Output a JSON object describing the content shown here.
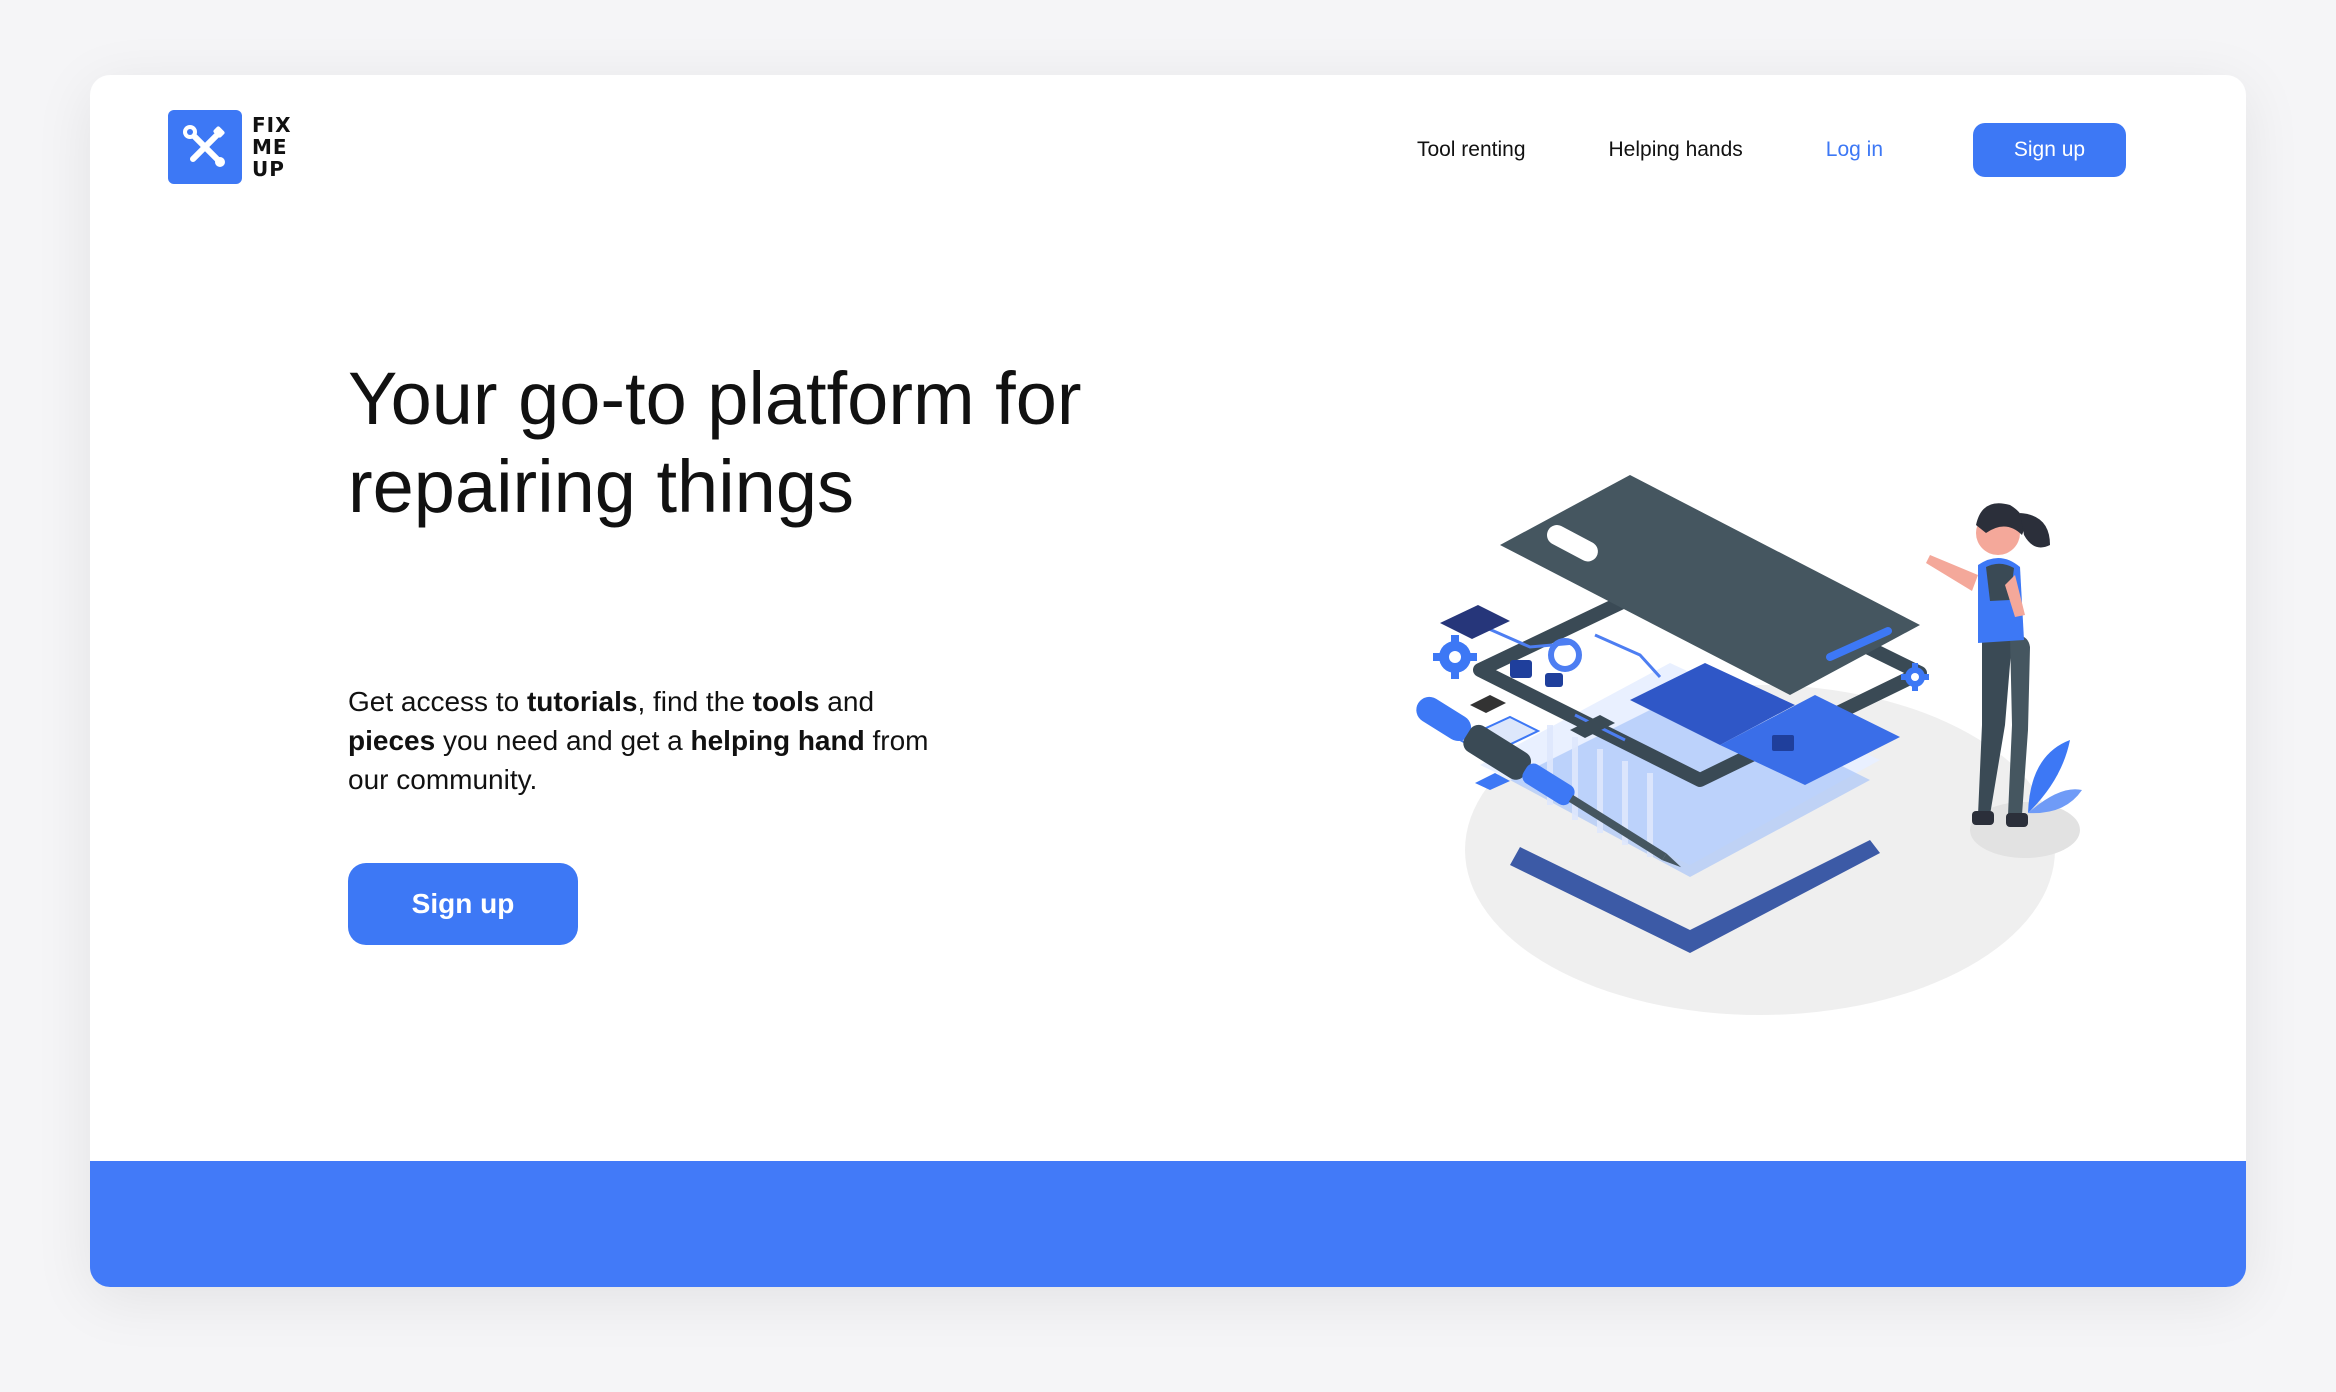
{
  "brand": {
    "logo_line1": "FIX",
    "logo_line2": "ME",
    "logo_line3": "UP",
    "logo_icon": "wrench-screwdriver-icon",
    "accent_color": "#3d78f5"
  },
  "nav": {
    "items": [
      {
        "label": "Tool renting"
      },
      {
        "label": "Helping hands"
      }
    ],
    "login_label": "Log in",
    "signup_label": "Sign up"
  },
  "hero": {
    "headline_line1": "Your go-to platform for",
    "headline_line2": "repairing things",
    "sub": {
      "t1": "Get access to ",
      "b1": "tutorials",
      "t2": ", find the ",
      "b2": "tools",
      "t3": " and",
      "b3": "pieces",
      "t4": " you need and get a ",
      "b4": "helping hand",
      "t5": " from",
      "t6": "our community."
    },
    "cta_label": "Sign up",
    "illustration": "phone-repair-illustration"
  },
  "footer": {
    "band_color": "#427af8"
  }
}
